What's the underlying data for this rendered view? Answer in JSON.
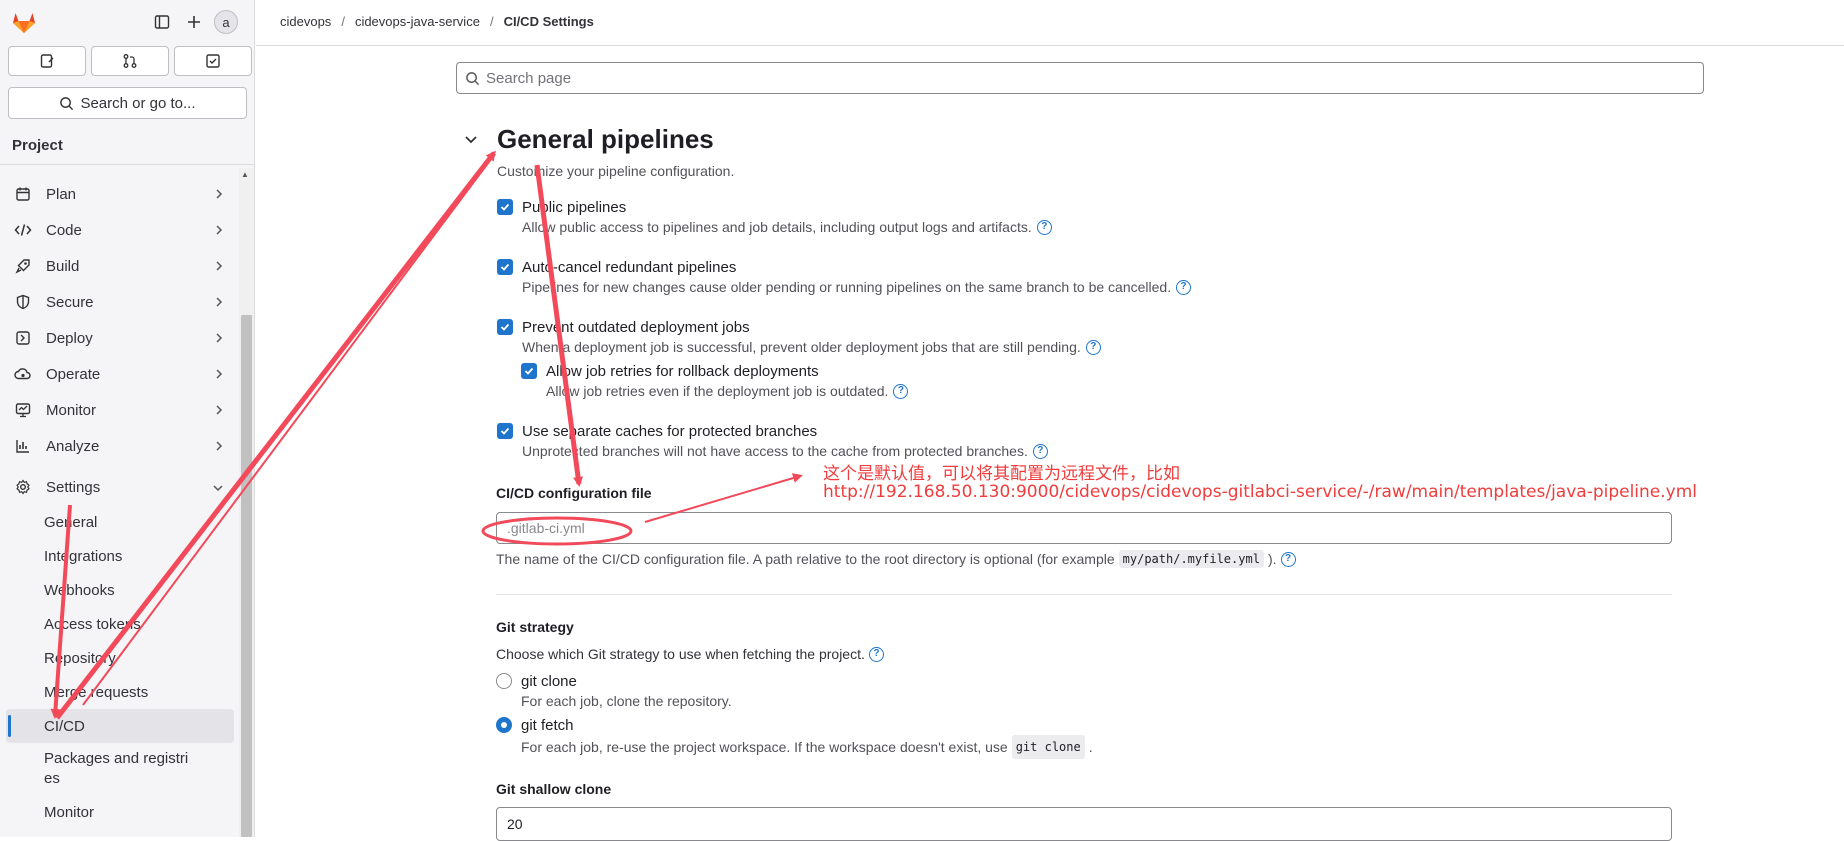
{
  "sidebar": {
    "avatar_text": "a",
    "search_label": "Search or go to...",
    "section_label": "Project",
    "nav": [
      {
        "label": "Plan",
        "icon": "plan-icon"
      },
      {
        "label": "Code",
        "icon": "code-icon"
      },
      {
        "label": "Build",
        "icon": "rocket-icon"
      },
      {
        "label": "Secure",
        "icon": "shield-icon"
      },
      {
        "label": "Deploy",
        "icon": "deploy-icon"
      },
      {
        "label": "Operate",
        "icon": "cloud-gear-icon"
      },
      {
        "label": "Monitor",
        "icon": "monitor-icon"
      },
      {
        "label": "Analyze",
        "icon": "chart-icon"
      }
    ],
    "settings_label": "Settings",
    "settings_items": [
      "General",
      "Integrations",
      "Webhooks",
      "Access tokens",
      "Repository",
      "Merge requests",
      "CI/CD",
      "Packages and registries",
      "Monitor"
    ]
  },
  "breadcrumb": [
    "cidevops",
    "cidevops-java-service",
    "CI/CD Settings"
  ],
  "search": {
    "placeholder": "Search page"
  },
  "section": {
    "title": "General pipelines",
    "description": "Customize your pipeline configuration.",
    "options": [
      {
        "label": "Public pipelines",
        "help": "Allow public access to pipelines and job details, including output logs and artifacts.",
        "checked": true
      },
      {
        "label": "Auto-cancel redundant pipelines",
        "help": "Pipelines for new changes cause older pending or running pipelines on the same branch to be cancelled.",
        "checked": true
      },
      {
        "label": "Prevent outdated deployment jobs",
        "help": "When a deployment job is successful, prevent older deployment jobs that are still pending.",
        "checked": true
      },
      {
        "label": "Allow job retries for rollback deployments",
        "help": "Allow job retries even if the deployment job is outdated.",
        "checked": true
      },
      {
        "label": "Use separate caches for protected branches",
        "help": "Unprotected branches will not have access to the cache from protected branches.",
        "checked": true
      }
    ],
    "config_file": {
      "label": "CI/CD configuration file",
      "placeholder": ".gitlab-ci.yml",
      "help_before": "The name of the CI/CD configuration file. A path relative to the root directory is optional (for example",
      "help_code": "my/path/.myfile.yml",
      "help_after": ")."
    },
    "git_strategy": {
      "label": "Git strategy",
      "help": "Choose which Git strategy to use when fetching the project.",
      "options": [
        {
          "label": "git clone",
          "help": "For each job, clone the repository.",
          "selected": false
        },
        {
          "label": "git fetch",
          "help_before": "For each job, re-use the project workspace. If the workspace doesn't exist, use",
          "help_code": "git clone",
          "help_after": ".",
          "selected": true
        }
      ]
    },
    "shallow_clone": {
      "label": "Git shallow clone",
      "value": "20"
    }
  },
  "annotation": {
    "line1": "这个是默认值，可以将其配置为远程文件，比如",
    "line2": "http://192.168.50.130:9000/cidevops/cidevops-gitlabci-service/-/raw/main/templates/java-pipeline.yml",
    "color": "#f03c3c"
  },
  "colors": {
    "accent": "#1f75cb",
    "sidebar_bg": "#f5f5f7"
  }
}
